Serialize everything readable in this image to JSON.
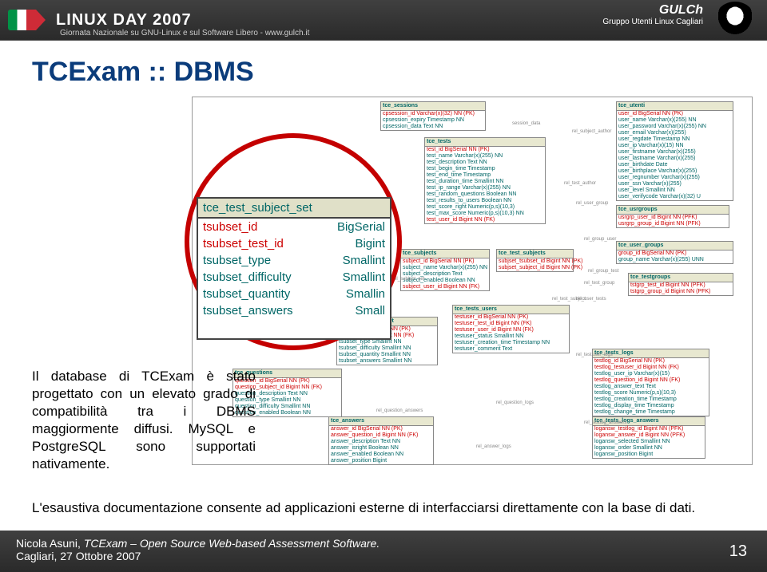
{
  "header": {
    "title": "LINUX DAY 2007",
    "subtitle": "Giornata Nazionale su GNU-Linux e sul Software Libero - www.gulch.it",
    "org": "GULCh",
    "org_sub": "Gruppo Utenti Linux Cagliari"
  },
  "slide": {
    "h1": "TCExam :: DBMS",
    "para1": "Il database di TCExam è stato progettato con un elevato grado di compatibilità tra i DBMS maggiormente diffusi. MySQL e PostgreSQL sono supportati nativamente.",
    "para2": "L'esaustiva documentazione consente ad applicazioni esterne di interfacciarsi direttamente con la base di dati."
  },
  "zoom": {
    "head": "tce_test_subject_set",
    "rows": [
      {
        "name": "tsubset_id",
        "type": "BigSerial",
        "key": true
      },
      {
        "name": "tsubset_test_id",
        "type": "Bigint",
        "key": true
      },
      {
        "name": "tsubset_type",
        "type": "Smallint",
        "key": false
      },
      {
        "name": "tsubset_difficulty",
        "type": "Smallint",
        "key": false
      },
      {
        "name": "tsubset_quantity",
        "type": "Smallin",
        "key": false
      },
      {
        "name": "tsubset_answers",
        "type": "Small",
        "key": false
      }
    ]
  },
  "tables": {
    "sessions": {
      "name": "tce_sessions",
      "fields": [
        "cpsession_id  Varchar(x)(32) NN (PK)",
        "cpsession_expiry Timestamp  NN",
        "cpsession_data Text  NN"
      ]
    },
    "utenti": {
      "name": "tce_utenti",
      "fields": [
        "user_id  BigSerial  NN (PK)",
        "user_name  Varchar(x)(255) NN",
        "user_password  Varchar(x)(255) NN",
        "user_email  Varchar(x)(255)",
        "user_regdate  Timestamp  NN",
        "user_ip  Varchar(x)(15) NN",
        "user_firstname  Varchar(x)(255)",
        "user_lastname  Varchar(x)(255)",
        "user_birthdate  Date",
        "user_birthplace Varchar(x)(255)",
        "user_regnumber Varchar(x)(255)",
        "user_ssn  Varchar(x)(255)",
        "user_level  Smallint  NN",
        "user_verifycode Varchar(x)(32) U"
      ]
    },
    "tests": {
      "name": "tce_tests",
      "fields": [
        "test_id  BigSerial  NN (PK)",
        "test_name  Varchar(x)(255) NN",
        "test_description  Text  NN",
        "test_begin_time  Timestamp",
        "test_end_time  Timestamp",
        "test_duration_time Smallint  NN",
        "test_ip_range  Varchar(x)(255) NN",
        "test_random_questions Boolean NN",
        "test_results_to_users Boolean NN",
        "test_score_right  Numeric(p,s)(10,3)",
        "test_max_score  Numeric(p,s)(10,3) NN",
        "test_user_id  Bigint  NN (FK)"
      ]
    },
    "testsubjset": {
      "name": "tce_test_subject_set",
      "fields": [
        "tsubset_id  BigSerial NN (PK)",
        "tsubset_test_id Bigint NN (FK)",
        "tsubset_type  Smallint NN",
        "tsubset_difficulty Smallint NN",
        "tsubset_quantity Smallint NN",
        "tsubset_answers Smallint NN"
      ]
    },
    "subjects": {
      "name": "tce_subjects",
      "fields": [
        "subject_id BigSerial NN (PK)",
        "subject_name Varchar(x)(255) NN",
        "subject_description Text",
        "subject_enabled Boolean NN",
        "subject_user_id Bigint NN (FK)"
      ]
    },
    "testsubjects": {
      "name": "tce_test_subjects",
      "fields": [
        "subjset_tsubset_id Bigint NN (PK)",
        "subjset_subject_id Bigint NN (PK)"
      ]
    },
    "questions": {
      "name": "tce_questions",
      "fields": [
        "question_id  BigSerial NN (PK)",
        "question_subject_id Bigint NN (FK)",
        "question_description Text  NN",
        "question_type  Smallint NN",
        "question_difficulty Smallint NN",
        "question_enabled Boolean NN"
      ]
    },
    "answers": {
      "name": "tce_answers",
      "fields": [
        "answer_id  BigSerial NN (PK)",
        "answer_question_id Bigint NN (FK)",
        "answer_description Text  NN",
        "answer_isright  Boolean  NN",
        "answer_enabled  Boolean  NN",
        "answer_position  Bigint"
      ]
    },
    "usrgroups": {
      "name": "tce_usrgroups",
      "fields": [
        "usrgrp_user_id Bigint NN (PFK)",
        "usrgrp_group_id Bigint NN (PFK)"
      ]
    },
    "usergroups": {
      "name": "tce_user_groups",
      "fields": [
        "group_id  BigSerial  NN (PK)",
        "group_name Varchar(x)(255) UNN"
      ]
    },
    "testgroups": {
      "name": "tce_testgroups",
      "fields": [
        "tstgrp_test_id  Bigint NN (PFK)",
        "tstgrp_group_id Bigint NN (PFK)"
      ]
    },
    "testusers": {
      "name": "tce_tests_users",
      "fields": [
        "testuser_id  BigSerial NN (PK)",
        "testuser_test_id  Bigint  NN (FK)",
        "testuser_user_id  Bigint  NN (FK)",
        "testuser_status  Smallint NN",
        "testuser_creation_time Timestamp NN",
        "testuser_comment Text"
      ]
    },
    "testslogs": {
      "name": "tce_tests_logs",
      "fields": [
        "testlog_id  BigSerial  NN (PK)",
        "testlog_testuser_id Bigint  NN (FK)",
        "testlog_user_ip Varchar(x)(15)",
        "testlog_question_id Bigint  NN (FK)",
        "testlog_answer_text Text",
        "testlog_score  Numeric(p,s)(10,3)",
        "testlog_creation_time Timestamp",
        "testlog_display_time Timestamp",
        "testlog_change_time Timestamp"
      ]
    },
    "testslogsanswers": {
      "name": "tce_tests_logs_answers",
      "fields": [
        "logansw_testlog_id Bigint  NN (PFK)",
        "logansw_answer_id Bigint  NN (PFK)",
        "logansw_selected Smallint NN",
        "logansw_order  Smallint NN",
        "logansw_position Bigint"
      ]
    }
  },
  "rels": [
    "session_data",
    "rel_subject_author",
    "rel_test_author",
    "rel_user_group",
    "rel_group_user",
    "rel_subject_set",
    "rel_test_subject",
    "rel_user_tests",
    "rel_test_group",
    "rel_group_test",
    "rel_question_answers",
    "rel_answer_logs",
    "rel_question_logs",
    "rel_testuser_logs",
    "rel_testlog_answers"
  ],
  "footer": {
    "author": "Nicola Asuni, ",
    "title": "TCExam – Open Source Web-based Assessment Software.",
    "location": "Cagliari, 27 Ottobre 2007",
    "page": "13"
  }
}
